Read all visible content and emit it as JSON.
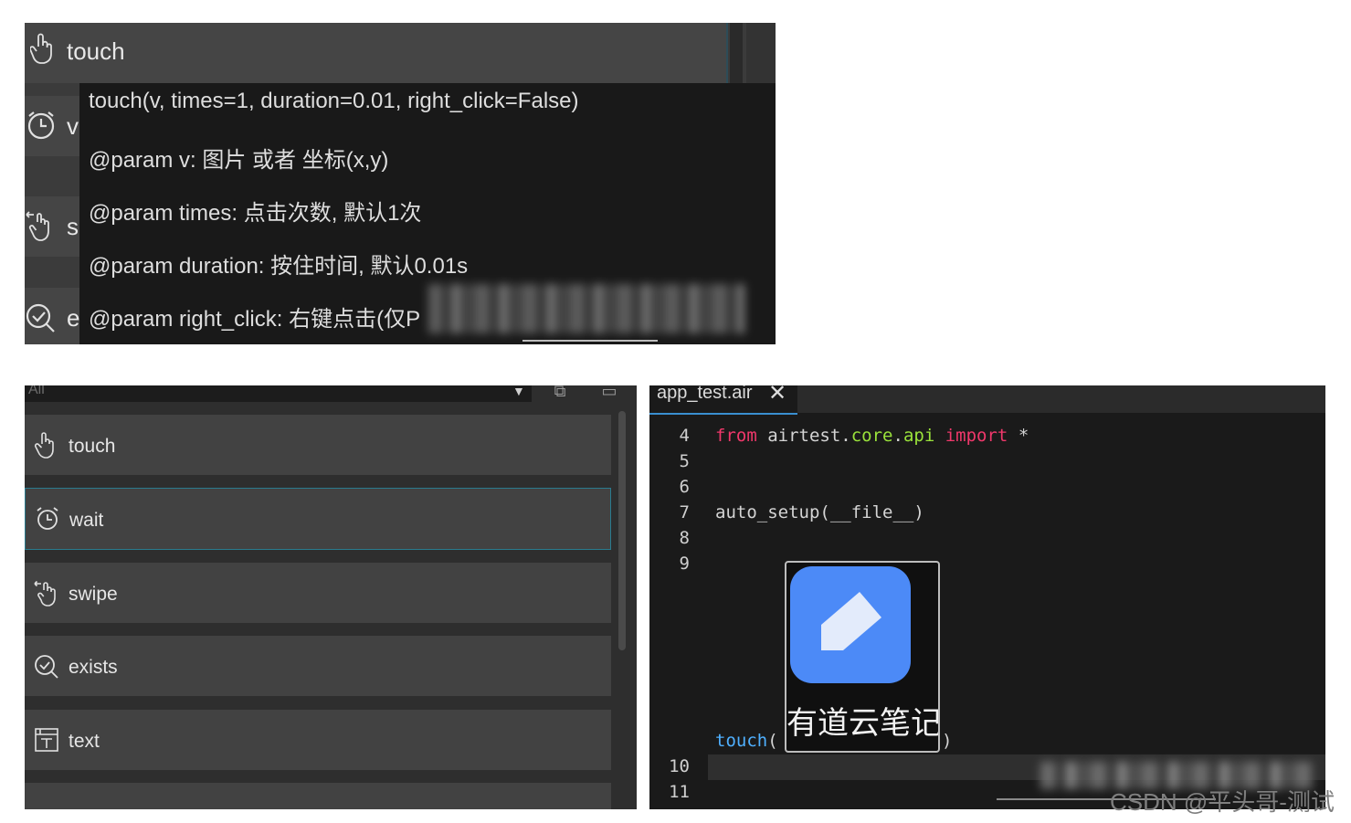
{
  "top_panel": {
    "header_label": "touch",
    "peek_labels": [
      "v",
      "s",
      "e"
    ],
    "tooltip_lines": [
      "touch(v, times=1, duration=0.01, right_click=False)",
      "@param v: 图片 或者 坐标(x,y)",
      "@param times: 点击次数, 默认1次",
      "@param duration: 按住时间, 默认0.01s",
      "@param right_click: 右键点击(仅P"
    ]
  },
  "left_panel": {
    "filter_value": "All",
    "items": [
      {
        "label": "touch",
        "icon": "hand-pointer-icon"
      },
      {
        "label": "wait",
        "icon": "alarm-clock-icon"
      },
      {
        "label": "swipe",
        "icon": "swipe-hand-icon"
      },
      {
        "label": "exists",
        "icon": "check-search-icon"
      },
      {
        "label": "text",
        "icon": "text-field-icon"
      }
    ]
  },
  "editor": {
    "tab_label": "app_test.air",
    "tab_close": "✕",
    "line_numbers": [
      "4",
      "5",
      "6",
      "7",
      "8",
      "9",
      "10",
      "11"
    ],
    "code": {
      "line4_from": "from",
      "line4_module": "airtest.",
      "line4_core": "core",
      "line4_dot": ".",
      "line4_api": "api",
      "line4_import": "import",
      "line4_star": "*",
      "line7": "auto_setup(__file__)",
      "line9_fn": "touch",
      "line9_open": "(",
      "line9_close": ")"
    },
    "image_caption": "有道云笔记"
  },
  "watermark": "CSDN @平头哥-测试",
  "colors": {
    "keyword": "#f0386b",
    "module": "#9ae23b",
    "function": "#4fb0ff",
    "accent": "#3a8fd0"
  }
}
